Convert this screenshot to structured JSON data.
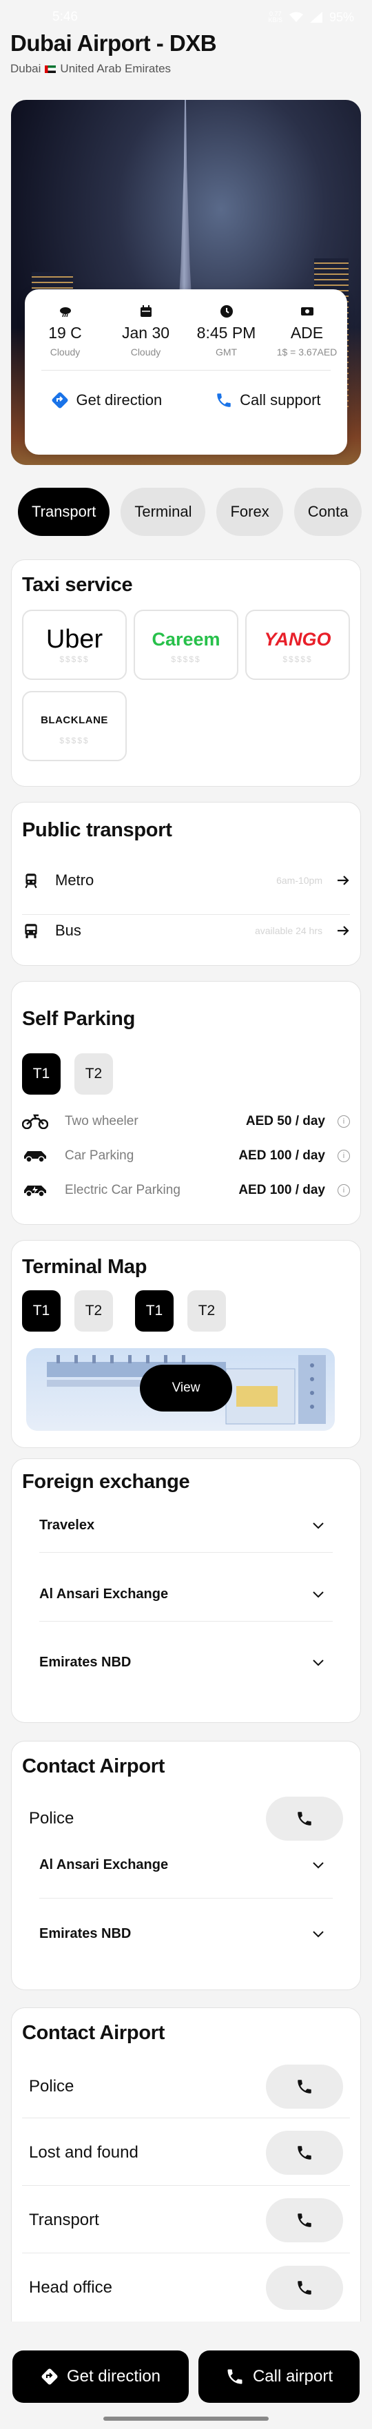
{
  "status_bar": {
    "time": "5:46",
    "net_speed": "0.77",
    "net_unit": "KB/S",
    "battery": "95%"
  },
  "header": {
    "title": "Dubai Airport - DXB",
    "city": "Dubai",
    "country": "United Arab Emirates"
  },
  "info": {
    "items": [
      {
        "value": "19 C",
        "label": "Cloudy",
        "icon": "weather-cloud-icon"
      },
      {
        "value": "Jan 30",
        "label": "Cloudy",
        "icon": "calendar-icon"
      },
      {
        "value": "8:45 PM",
        "label": "GMT",
        "icon": "clock-icon"
      },
      {
        "value": "ADE",
        "label": "1$ = 3.67AED",
        "icon": "cash-icon"
      }
    ],
    "get_direction": "Get direction",
    "call_support": "Call support"
  },
  "tabs": [
    "Transport",
    "Terminal",
    "Forex",
    "Conta"
  ],
  "taxi": {
    "title": "Taxi service",
    "items": [
      {
        "name": "Uber",
        "price": "$$$$$",
        "color": "#000000"
      },
      {
        "name": "Careem",
        "price": "$$$$$",
        "color": "#27c04a"
      },
      {
        "name": "YANGO",
        "price": "$$$$$",
        "color": "#e8202a"
      },
      {
        "name": "BLACKLANE",
        "price": "$$$$$",
        "color": "#111111"
      }
    ]
  },
  "public_transport": {
    "title": "Public transport",
    "items": [
      {
        "name": "Metro",
        "note": "6am-10pm"
      },
      {
        "name": "Bus",
        "note": "available 24 hrs"
      }
    ]
  },
  "parking": {
    "title": "Self Parking",
    "terminals": [
      "T1",
      "T2"
    ],
    "items": [
      {
        "name": "Two wheeler",
        "price": "AED 50 / day"
      },
      {
        "name": "Car Parking",
        "price": "AED 100 / day"
      },
      {
        "name": "Electric Car Parking",
        "price": "AED 100 / day"
      }
    ]
  },
  "terminal_map": {
    "title": "Terminal Map",
    "terminals": [
      "T1",
      "T2",
      "T1",
      "T2"
    ],
    "view": "View"
  },
  "forex": {
    "title": "Foreign exchange",
    "items": [
      "Travelex",
      "Al Ansari Exchange",
      "Emirates NBD"
    ]
  },
  "contact1": {
    "title": "Contact Airport",
    "police": "Police",
    "items": [
      "Al Ansari Exchange",
      "Emirates NBD"
    ]
  },
  "contact2": {
    "title": "Contact Airport",
    "items": [
      "Police",
      "Lost and found",
      "Transport",
      "Head office"
    ]
  },
  "bottom": {
    "get_direction": "Get direction",
    "call_airport": "Call airport"
  },
  "colors": {
    "accent_blue": "#1a73e8",
    "dark": "#000000"
  }
}
